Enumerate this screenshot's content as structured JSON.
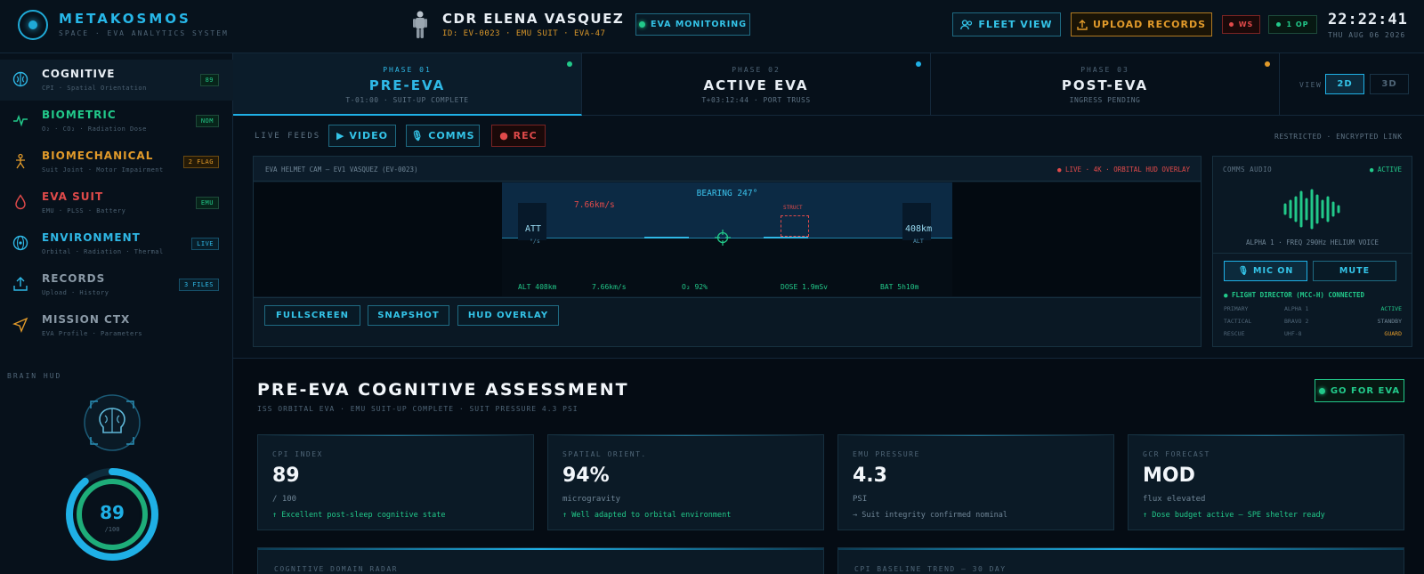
{
  "header": {
    "brand": "METAKOSMOS",
    "brand_sub": "SPACE · EVA ANALYTICS SYSTEM",
    "crew_name": "CDR ELENA VASQUEZ",
    "crew_id": "ID: EV-0023 · EMU SUIT · EVA-47",
    "status_pill": "EVA MONITORING",
    "fleet_btn": "FLEET VIEW",
    "upload_btn": "UPLOAD RECORDS",
    "ws_badge": "WS",
    "op_badge": "1 OP",
    "clock": "22:22:41",
    "date": "THU AUG 06 2026"
  },
  "sidebar": {
    "items": [
      {
        "title": "COGNITIVE",
        "sub": "CPI · Spatial Orientation",
        "badge": "89",
        "color": "#e8eef4"
      },
      {
        "title": "BIOMETRIC",
        "sub": "O₂ · CO₂ · Radiation Dose",
        "badge": "NOM",
        "color": "#22c98a"
      },
      {
        "title": "BIOMECHANICAL",
        "sub": "Suit Joint · Motor Impairment",
        "badge": "2 FLAG",
        "color": "#e19a2a"
      },
      {
        "title": "EVA SUIT",
        "sub": "EMU · PLSS · Battery",
        "badge": "EMU",
        "color": "#e04a4a"
      },
      {
        "title": "ENVIRONMENT",
        "sub": "Orbital · Radiation · Thermal",
        "badge": "LIVE",
        "color": "#2fb8e6"
      },
      {
        "title": "RECORDS",
        "sub": "Upload · History",
        "badge": "3 FILES",
        "color": "#8a99a6"
      },
      {
        "title": "MISSION CTX",
        "sub": "EVA Profile · Parameters",
        "badge": "",
        "color": "#8a99a6"
      }
    ],
    "brain_label": "BRAIN HUD",
    "gauge_value": "89",
    "gauge_total": "/100",
    "gauge_fraction": 0.89
  },
  "phases": [
    {
      "label": "PHASE 01",
      "title": "PRE-EVA",
      "sub": "T-01:00 · SUIT-UP COMPLETE"
    },
    {
      "label": "PHASE 02",
      "title": "ACTIVE EVA",
      "sub": "T+03:12:44 · PORT TRUSS"
    },
    {
      "label": "PHASE 03",
      "title": "POST-EVA",
      "sub": "INGRESS PENDING"
    }
  ],
  "view": {
    "label": "VIEW",
    "opt_2d": "2D",
    "opt_3d": "3D"
  },
  "feeds": {
    "label": "LIVE FEEDS",
    "video": "▶ VIDEO",
    "comms": "🎙 COMMS",
    "rec": "● REC",
    "security": "RESTRICTED · ENCRYPTED LINK",
    "cam_title": "EVA HELMET CAM — EV1 VASQUEZ (EV-0023)",
    "cam_status": "● LIVE · 4K · ORBITAL HUD OVERLAY",
    "bearing": "BEARING 247°",
    "speed": "7.66km/s",
    "att": "ATT",
    "att_unit": "°/s",
    "altitude": "408km",
    "alt_unit": "ALT",
    "struct": "STRUCT",
    "bottom": [
      "ALT 408km",
      "7.66km/s",
      "O₂ 92%",
      "DOSE 1.9mSv",
      "BAT 5h10m"
    ],
    "btn_fullscreen": "FULLSCREEN",
    "btn_snapshot": "SNAPSHOT",
    "btn_hud": "HUD OVERLAY"
  },
  "comms": {
    "title": "COMMS AUDIO",
    "status": "● ACTIVE",
    "freq": "ALPHA 1 · FREQ 290Hz HELIUM VOICE",
    "mic": "🎙 MIC ON",
    "mute": "MUTE",
    "connected": "● FLIGHT DIRECTOR (MCC-H) CONNECTED",
    "rows": [
      {
        "role": "PRIMARY",
        "name": "ALPHA 1",
        "state": "ACTIVE",
        "color": "#22c98a"
      },
      {
        "role": "TACTICAL",
        "name": "BRAVO 2",
        "state": "STANDBY",
        "color": "#6f8596"
      },
      {
        "role": "RESCUE",
        "name": "UHF-8",
        "state": "GUARD",
        "color": "#e19a2a"
      }
    ]
  },
  "assessment": {
    "title": "PRE-EVA COGNITIVE ASSESSMENT",
    "sub": "ISS ORBITAL EVA · EMU SUIT-UP COMPLETE · SUIT PRESSURE 4.3 PSI",
    "go_btn": "GO FOR EVA",
    "cards": [
      {
        "label": "CPI INDEX",
        "value": "89",
        "unit": "/ 100",
        "note": "↑ Excellent post-sleep cognitive state",
        "note_color": "#22c98a"
      },
      {
        "label": "SPATIAL ORIENT.",
        "value": "94%",
        "unit": "microgravity",
        "note": "↑ Well adapted to orbital environment",
        "note_color": "#22c98a"
      },
      {
        "label": "EMU PRESSURE",
        "value": "4.3",
        "unit": "PSI",
        "note": "→ Suit integrity confirmed nominal",
        "note_color": "#6f8596"
      },
      {
        "label": "GCR FORECAST",
        "value": "MOD",
        "unit": "flux elevated",
        "note": "↑ Dose budget active — SPE shelter ready",
        "note_color": "#22c98a"
      }
    ],
    "panel_left": "COGNITIVE DOMAIN RADAR",
    "panel_right": "CPI BASELINE TREND — 30 DAY"
  }
}
